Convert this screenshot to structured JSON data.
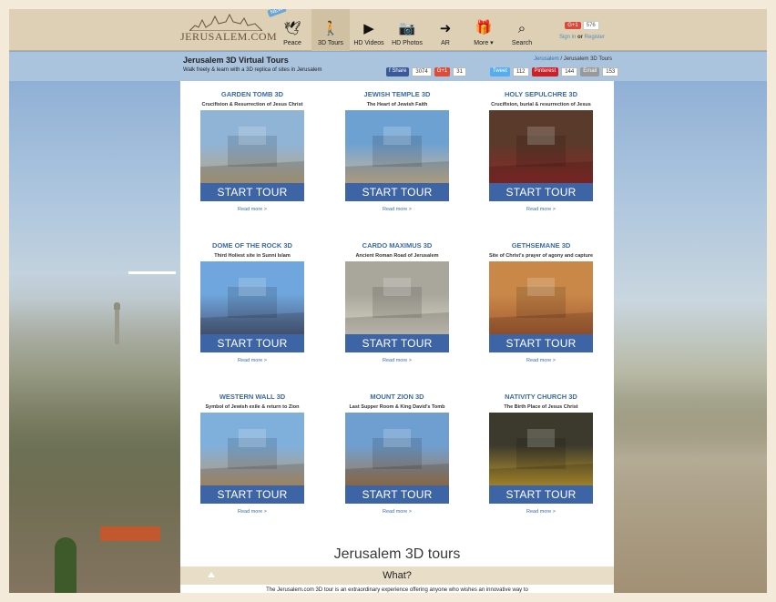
{
  "header": {
    "logo_text": "JERUSALEM.COM",
    "nav": [
      {
        "label": "Peace",
        "icon": "dove-icon",
        "glyph": "🕊",
        "badge": "NEW",
        "active": false
      },
      {
        "label": "3D Tours",
        "icon": "walking-person-icon",
        "glyph": "🚶",
        "badge": "",
        "active": true
      },
      {
        "label": "HD Videos",
        "icon": "video-icon",
        "glyph": "▶",
        "badge": "",
        "active": false
      },
      {
        "label": "HD Photos",
        "icon": "camera-icon",
        "glyph": "📷",
        "badge": "",
        "active": false
      },
      {
        "label": "AR",
        "icon": "ar-arrow-icon",
        "glyph": "➜",
        "badge": "",
        "active": false
      },
      {
        "label": "More ▾",
        "icon": "gift-icon",
        "glyph": "🎁",
        "badge": "",
        "active": false
      },
      {
        "label": "Search",
        "icon": "search-icon",
        "glyph": "⌕",
        "badge": "",
        "active": false
      }
    ],
    "auth": {
      "gplus_label": "G+1",
      "gplus_count": "576",
      "signin": "Sign in",
      "or": "or",
      "register": "Register"
    }
  },
  "subheader": {
    "title": "Jerusalem 3D Virtual Tours",
    "description": "Walk freely & learn with a 3D replica of sites in Jerusalem",
    "breadcrumb_root": "Jerusalem",
    "breadcrumb_current": "Jerusalem 3D Tours",
    "social": [
      {
        "label": "f Share",
        "count": "3074",
        "color": "#3b5998"
      },
      {
        "label": "G+1",
        "count": "31",
        "color": "#dd4b39"
      },
      {
        "label": "Tweet",
        "count": "112",
        "color": "#55acee"
      },
      {
        "label": "Pinterest",
        "count": "144",
        "color": "#cb2027"
      },
      {
        "label": "Email",
        "count": "153",
        "color": "#999999"
      }
    ]
  },
  "tours": [
    {
      "title": "GARDEN TOMB 3D",
      "subtitle": "Crucifixion & Resurrection of Jesus Christ",
      "cta": "START TOUR",
      "more": "Read more >",
      "sky": "#8fb4d6",
      "ground": "#b7a682"
    },
    {
      "title": "JEWISH TEMPLE 3D",
      "subtitle": "The Heart of Jewish Faith",
      "cta": "START TOUR",
      "more": "Read more >",
      "sky": "#6da1d2",
      "ground": "#c9b796"
    },
    {
      "title": "HOLY SEPULCHRE 3D",
      "subtitle": "Crucifixion, burial & resurrection of Jesus",
      "cta": "START TOUR",
      "more": "Read more >",
      "sky": "#5a3a2a",
      "ground": "#8c2a28"
    },
    {
      "title": "DOME OF THE ROCK 3D",
      "subtitle": "Third Holiest site in Sunni Islam",
      "cta": "START TOUR",
      "more": "Read more >",
      "sky": "#6ea6dd",
      "ground": "#4f5d7e"
    },
    {
      "title": "CARDO MAXIMUS 3D",
      "subtitle": "Ancient Roman Road of Jerusalem",
      "cta": "START TOUR",
      "more": "Read more >",
      "sky": "#a9a79c",
      "ground": "#d6d1c4"
    },
    {
      "title": "GETHSEMANE 3D",
      "subtitle": "Site of Christ's prayer of agony and capture",
      "cta": "START TOUR",
      "more": "Read more >",
      "sky": "#c98848",
      "ground": "#a65b33"
    },
    {
      "title": "WESTERN WALL 3D",
      "subtitle": "Symbol of Jewish exile & return to Zion",
      "cta": "START TOUR",
      "more": "Read more >",
      "sky": "#7fb0dc",
      "ground": "#b89b73"
    },
    {
      "title": "MOUNT ZION 3D",
      "subtitle": "Last Supper Room & King David's Tomb",
      "cta": "START TOUR",
      "more": "Read more >",
      "sky": "#6f9fd0",
      "ground": "#a07a52"
    },
    {
      "title": "NATIVITY CHURCH 3D",
      "subtitle": "The Birth Place of Jesus Christ",
      "cta": "START TOUR",
      "more": "Read more >",
      "sky": "#3c3a2c",
      "ground": "#b9962e"
    }
  ],
  "section": {
    "heading": "Jerusalem 3D tours",
    "accordion_label": "What?",
    "intro": "The Jerusalem.com 3D tour is an extraordinary experience offering anyone who wishes an innovative way to"
  }
}
